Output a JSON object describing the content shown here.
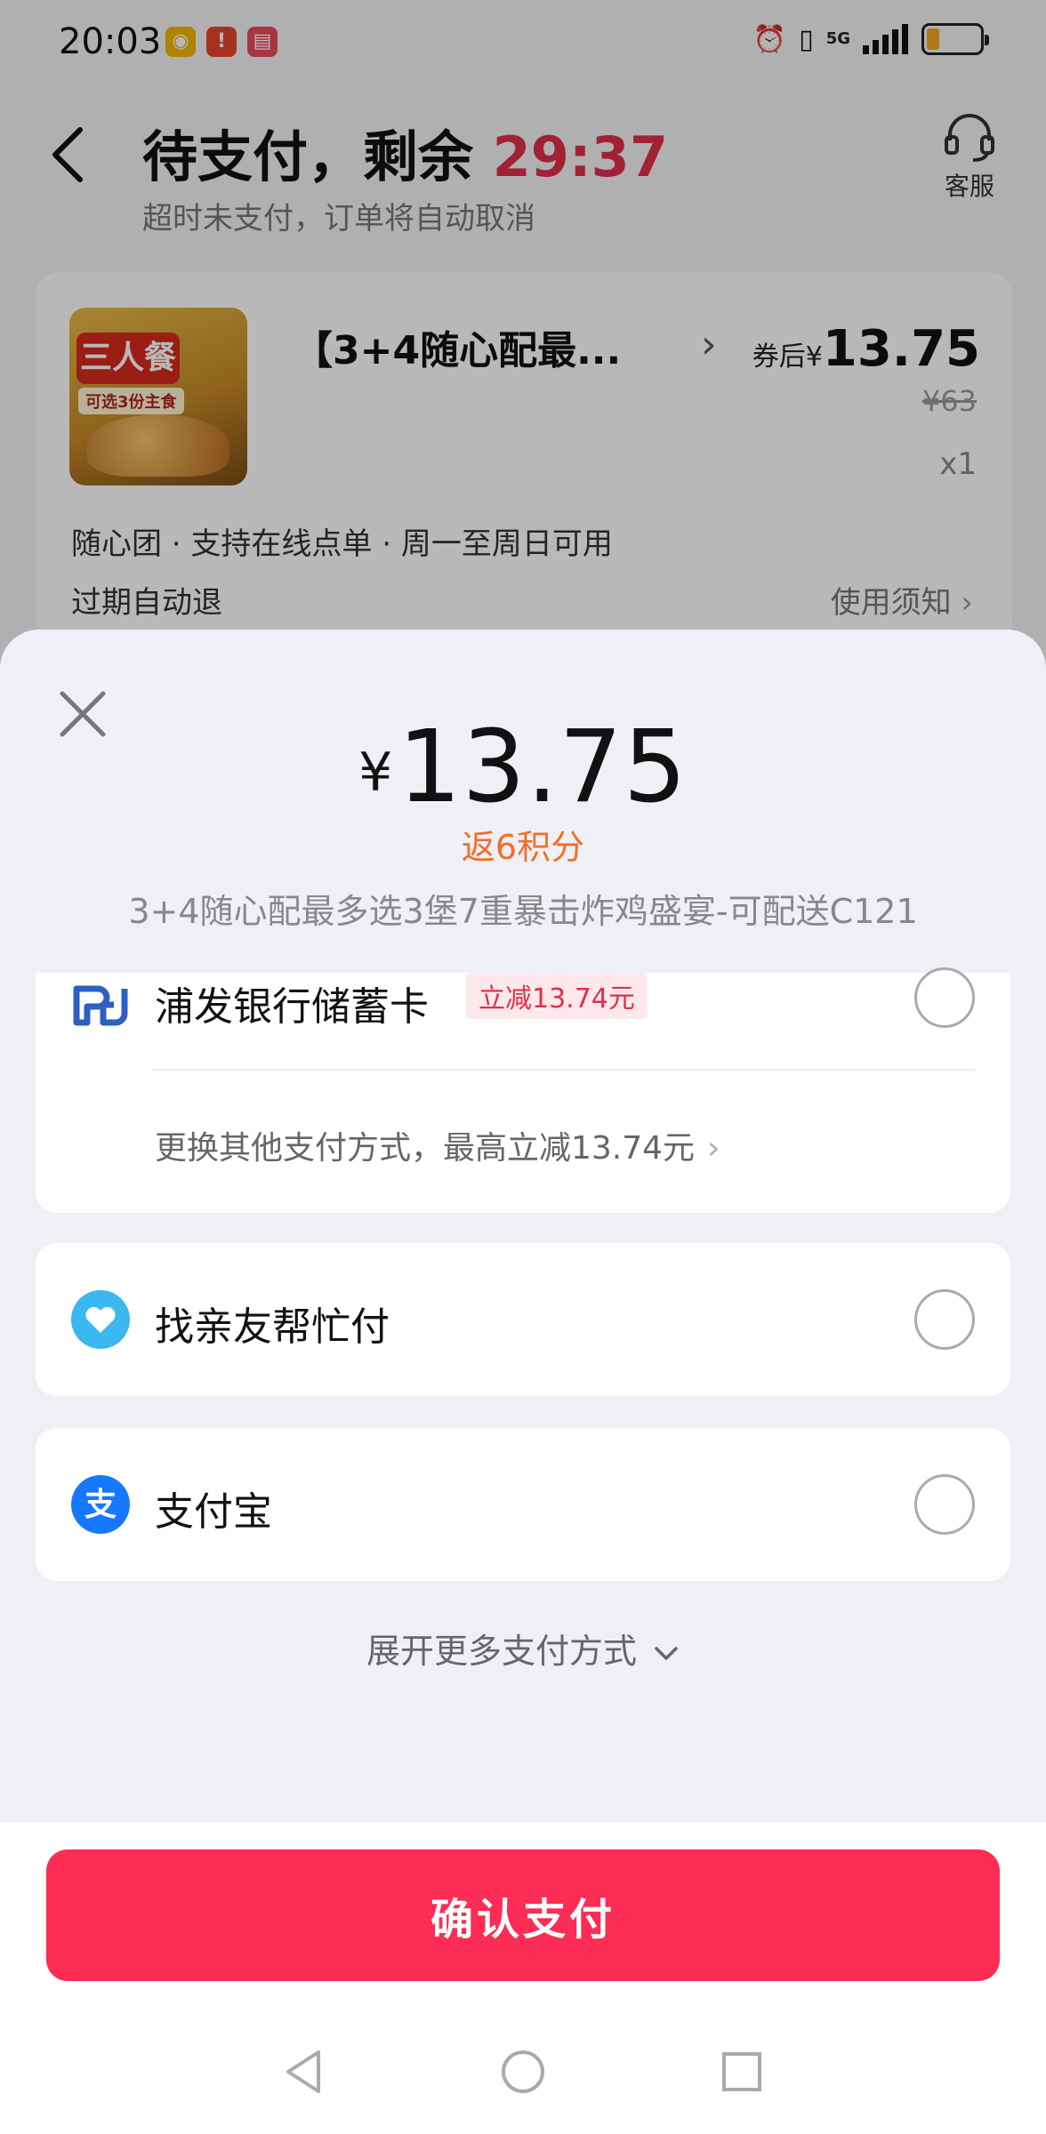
{
  "status_bar": {
    "time": "20:03",
    "apps": [
      "weibo-icon",
      "notification-icon",
      "reader-icon"
    ],
    "icons": [
      "alarm-icon",
      "vibrate-icon",
      "5g-signal-icon",
      "battery-icon"
    ],
    "network": "5G",
    "battery_level": 0.2
  },
  "header": {
    "title_prefix": "待支付，剩余",
    "countdown": "29:37",
    "subtitle": "超时未支付，订单将自动取消",
    "service_label": "客服"
  },
  "order": {
    "product_name": "【3+4随心配最...",
    "image_tag": "三人餐",
    "image_subtag": "可选3份主食",
    "price_label": "券后¥",
    "price": "13.75",
    "original_price": "¥63",
    "quantity": "x1",
    "tags": "随心团 · 支持在线点单 · 周一至周日可用",
    "refund": "过期自动退",
    "notice": "使用须知"
  },
  "sheet": {
    "currency": "¥",
    "amount": "13.75",
    "points": "返6积分",
    "description": "3+4随心配最多选3堡7重暴击炸鸡盛宴-可配送C121"
  },
  "payment_methods": [
    {
      "label": "浦发银行储蓄卡",
      "promo": "立减13.74元",
      "icon": "spdb-bank-icon",
      "selected": false
    },
    {
      "label": "找亲友帮忙付",
      "icon": "heart-icon",
      "selected": false
    },
    {
      "label": "支付宝",
      "icon": "alipay-icon",
      "selected": false
    }
  ],
  "switch_method": "更换其他支付方式，最高立减13.74元",
  "more_methods": "展开更多支付方式",
  "confirm_button": "确认支付",
  "colors": {
    "accent": "#fb2d55",
    "countdown": "#e0304a",
    "points": "#f26d2b",
    "alipay": "#1677ff",
    "friend": "#3bb8f0"
  }
}
